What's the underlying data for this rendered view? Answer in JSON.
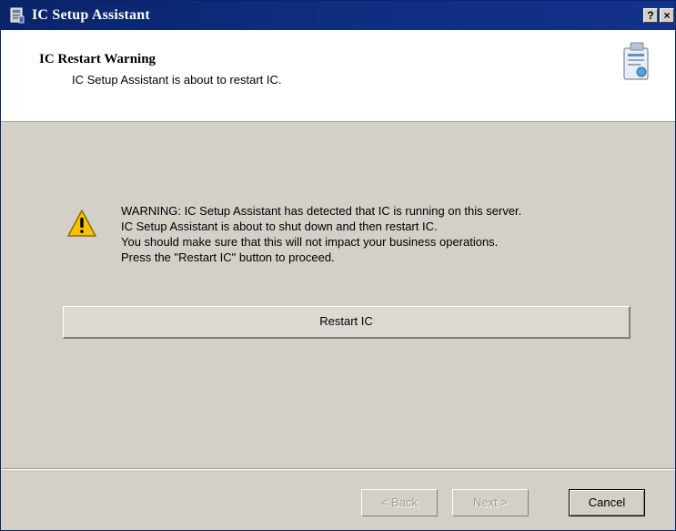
{
  "window": {
    "title": "IC Setup Assistant",
    "help_label": "?",
    "close_label": "×"
  },
  "header": {
    "title": "IC Restart Warning",
    "subtitle": "IC Setup Assistant is about to restart IC."
  },
  "warning": {
    "icon": "warning-triangle-icon",
    "lines": [
      "WARNING:  IC Setup Assistant has detected that IC is running on this server.",
      "IC Setup Assistant is about to shut down and then restart IC.",
      "You should make sure that this will not impact your business operations.",
      "Press the \"Restart IC\" button to proceed."
    ]
  },
  "actions": {
    "restart_label": "Restart IC"
  },
  "nav": {
    "back_label": "< Back",
    "next_label": "Next >",
    "cancel_label": "Cancel"
  },
  "colors": {
    "titlebar": "#0a246a",
    "dialog_face": "#d4d0c8",
    "warning_yellow": "#f5c400"
  }
}
